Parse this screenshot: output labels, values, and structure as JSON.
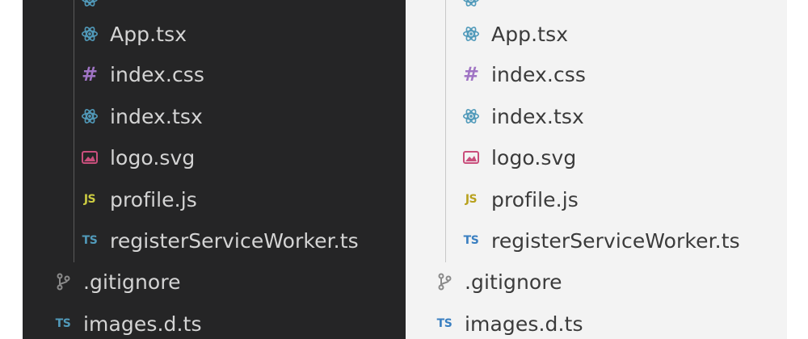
{
  "colors": {
    "dark_bg": "#252526",
    "light_bg": "#f3f3f3",
    "react": "#519aba",
    "css": "#a074c4",
    "svg_img": "#c94f7c",
    "js": "#cbcb41",
    "ts": "#519aba",
    "git": "#8a8a8a"
  },
  "dark_panel": {
    "files": [
      {
        "name": "App.tsx",
        "icon": "react-icon"
      },
      {
        "name": "index.css",
        "icon": "hash-icon"
      },
      {
        "name": "index.tsx",
        "icon": "react-icon"
      },
      {
        "name": "logo.svg",
        "icon": "image-icon"
      },
      {
        "name": "profile.js",
        "icon": "js-icon"
      },
      {
        "name": "registerServiceWorker.ts",
        "icon": "ts-icon"
      },
      {
        "name": ".gitignore",
        "icon": "git-icon"
      },
      {
        "name": "images.d.ts",
        "icon": "ts-icon"
      }
    ],
    "icon_labels": {
      "js": "JS",
      "ts": "TS",
      "hash": "#"
    }
  },
  "light_panel": {
    "files": [
      {
        "name": "App.tsx",
        "icon": "react-icon"
      },
      {
        "name": "index.css",
        "icon": "hash-icon"
      },
      {
        "name": "index.tsx",
        "icon": "react-icon"
      },
      {
        "name": "logo.svg",
        "icon": "image-icon"
      },
      {
        "name": "profile.js",
        "icon": "js-icon"
      },
      {
        "name": "registerServiceWorker.ts",
        "icon": "ts-icon"
      },
      {
        "name": ".gitignore",
        "icon": "git-icon"
      },
      {
        "name": "images.d.ts",
        "icon": "ts-icon"
      }
    ],
    "icon_labels": {
      "js": "JS",
      "ts": "TS",
      "hash": "#"
    }
  }
}
